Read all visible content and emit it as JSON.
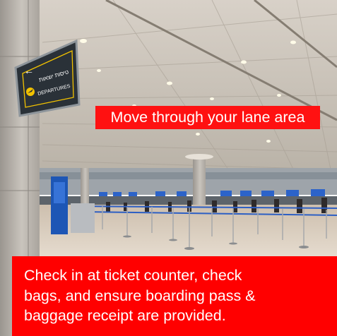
{
  "photo": {
    "sign": {
      "hebrew_label": "טיסות יוצאות",
      "english_label": "DEPARTURES",
      "arrow_glyph": "←",
      "icon": "airplane-departure-icon",
      "panel_color": "#2a3138",
      "accent_color": "#f2c200"
    }
  },
  "captions": {
    "lane": "Move through your lane area",
    "checkin_lines": [
      "Check in at ticket counter, check",
      "bags, and ensure boarding pass &",
      "baggage receipt are provided."
    ],
    "background_color": "#ff0000",
    "text_color": "#ffffff"
  }
}
